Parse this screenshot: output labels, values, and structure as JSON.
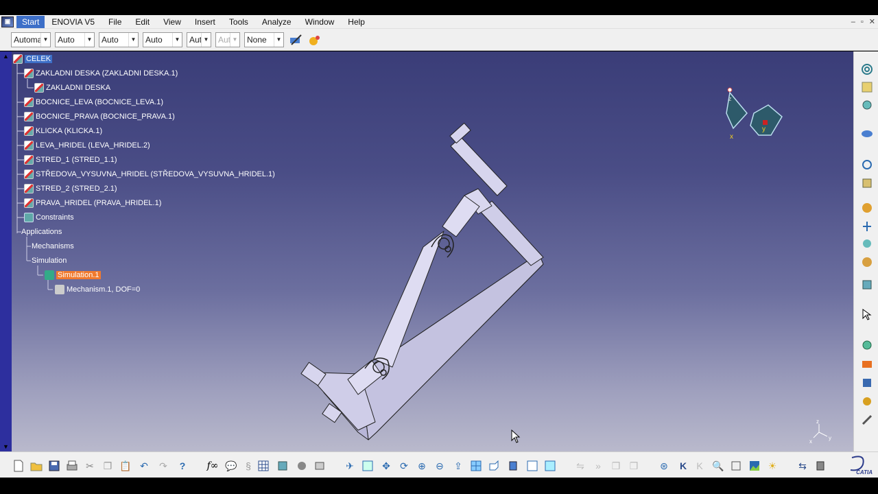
{
  "menubar": {
    "items": [
      "Start",
      "ENOVIA V5",
      "File",
      "Edit",
      "View",
      "Insert",
      "Tools",
      "Analyze",
      "Window",
      "Help"
    ],
    "window_controls": [
      "–",
      "▫",
      "✕"
    ]
  },
  "toolbar": {
    "dropdowns": [
      {
        "value": "Automa",
        "disabled": false
      },
      {
        "value": "Auto",
        "disabled": false
      },
      {
        "value": "Auto",
        "disabled": false
      },
      {
        "value": "Auto",
        "disabled": false
      },
      {
        "value": "Aut",
        "disabled": false
      },
      {
        "value": "Aut",
        "disabled": true
      },
      {
        "value": "None",
        "disabled": false
      }
    ],
    "icons": [
      "painter-icon",
      "graphic-properties-icon"
    ]
  },
  "tree": {
    "root": "CELEK",
    "items": [
      {
        "label": "ZAKLADNI DESKA (ZAKLADNI DESKA.1)",
        "icon": "part"
      },
      {
        "label": "ZAKLADNI DESKA",
        "icon": "part"
      },
      {
        "label": "BOCNICE_LEVA (BOCNICE_LEVA.1)",
        "icon": "part"
      },
      {
        "label": "BOCNICE_PRAVA (BOCNICE_PRAVA.1)",
        "icon": "part"
      },
      {
        "label": "KLICKA (KLICKA.1)",
        "icon": "part"
      },
      {
        "label": "LEVA_HRIDEL (LEVA_HRIDEL.2)",
        "icon": "part"
      },
      {
        "label": "STRED_1 (STRED_1.1)",
        "icon": "part"
      },
      {
        "label": "STŘEDOVA_VYSUVNA_HRIDEL (STŘEDOVA_VYSUVNA_HRIDEL.1)",
        "icon": "part"
      },
      {
        "label": "STRED_2 (STRED_2.1)",
        "icon": "part"
      },
      {
        "label": "PRAVA_HRIDEL (PRAVA_HRIDEL.1)",
        "icon": "part"
      },
      {
        "label": "Constraints",
        "icon": "constraints"
      },
      {
        "label": "Applications",
        "icon": "none"
      },
      {
        "label": "Mechanisms",
        "icon": "none"
      },
      {
        "label": "Simulation",
        "icon": "none"
      },
      {
        "label": "Simulation.1",
        "icon": "simulation"
      },
      {
        "label": "Mechanism.1, DOF=0",
        "icon": "mechanism"
      }
    ]
  },
  "compass": {
    "x_label": "x",
    "y_label": "y",
    "z_label": "z"
  },
  "triad": {
    "x_label": "x",
    "y_label": "y",
    "z_label": "z"
  },
  "bottom_toolbar": {
    "icons": [
      "new-icon",
      "open-icon",
      "save-icon",
      "print-icon",
      "cut-icon",
      "copy-icon",
      "paste-icon",
      "undo-icon",
      "redo-icon",
      "whats-this-icon",
      "formula-icon",
      "comment-icon",
      "knowledge-icon",
      "table-icon",
      "catalog-icon",
      "measure-icon",
      "sectioning-icon",
      "fly-mode-icon",
      "fit-all-icon",
      "pan-icon",
      "rotate-icon",
      "zoom-in-icon",
      "zoom-out-icon",
      "normal-view-icon",
      "multi-view-icon",
      "iso-view-icon",
      "shading-icon",
      "hide-show-icon",
      "swap-space-icon",
      "play-icon",
      "previous-icon",
      "first-icon",
      "next-icon",
      "last-icon",
      "target-icon",
      "back-icon",
      "forward-icon",
      "zoom-area-icon",
      "magnify-icon",
      "image-icon",
      "light-icon",
      "swap-icon",
      "snap-icon"
    ],
    "logo": "CATIA"
  },
  "right_toolbar": {
    "icons": [
      "spiral-icon",
      "assembly-icon",
      "product-icon",
      "kinematics-icon",
      "joint-icon",
      "fixed-icon",
      "simulate-icon",
      "sensor-icon",
      "analysis-icon",
      "clash-icon",
      "compile-icon",
      "trace-icon",
      "select-icon",
      "update-icon",
      "replay-icon",
      "catalog-browser-icon",
      "parts-icon",
      "tool-icon"
    ]
  }
}
